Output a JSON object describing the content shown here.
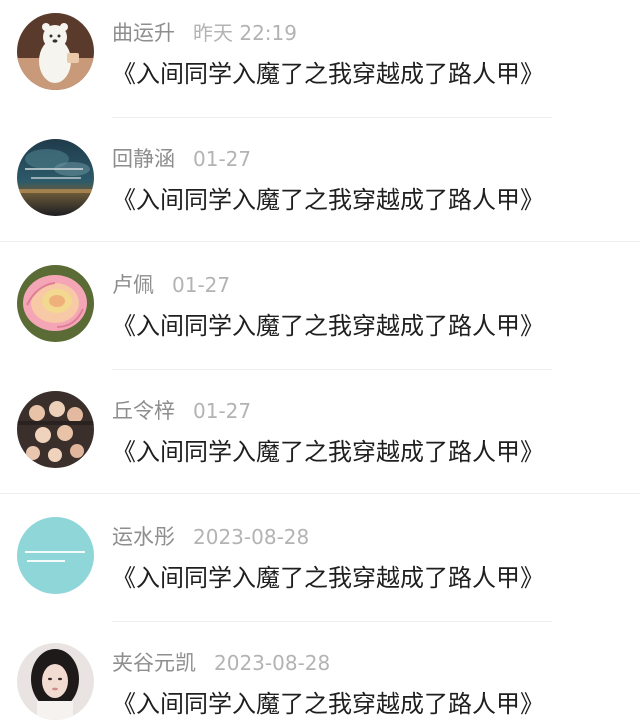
{
  "comments": [
    {
      "name": "曲运升",
      "time": "昨天 22:19",
      "text": "《入间同学入魔了之我穿越成了路人甲》",
      "avatar": "polar-bear"
    },
    {
      "name": "回静涵",
      "time": "01-27",
      "text": "《入间同学入魔了之我穿越成了路人甲》",
      "avatar": "night-sky-text"
    },
    {
      "name": "卢佩",
      "time": "01-27",
      "text": "《入间同学入魔了之我穿越成了路人甲》",
      "avatar": "pink-rose"
    },
    {
      "name": "丘令梓",
      "time": "01-27",
      "text": "《入间同学入魔了之我穿越成了路人甲》",
      "avatar": "group-photo"
    },
    {
      "name": "运水彤",
      "time": "2023-08-28",
      "text": "《入间同学入魔了之我穿越成了路人甲》",
      "avatar": "teal-text"
    },
    {
      "name": "夹谷元凯",
      "time": "2023-08-28",
      "text": "《入间同学入魔了之我穿越成了路人甲》",
      "avatar": "portrait"
    }
  ],
  "colors": {
    "name": "#8e8e8e",
    "time": "#b3b3b3",
    "text": "#1f1f1f",
    "separator": "#eeeeee"
  }
}
